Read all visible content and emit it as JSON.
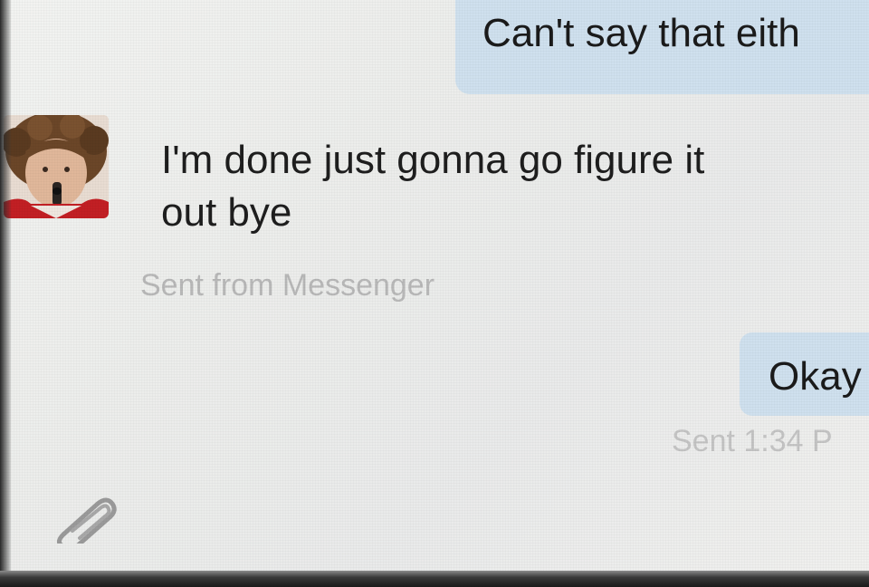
{
  "conversation": {
    "messages": [
      {
        "direction": "outgoing",
        "text": "Can't say that eith"
      },
      {
        "direction": "incoming",
        "text_line1": "I'm done just gonna go figure it",
        "text_line2": "out bye",
        "meta": "Sent from Messenger"
      },
      {
        "direction": "outgoing",
        "text": "Okay",
        "meta": "Sent 1:34 P"
      }
    ]
  },
  "icons": {
    "avatar": "contact-avatar-photo",
    "attach": "paperclip-icon"
  },
  "colors": {
    "outgoing_bubble": "#cfe0ee",
    "background": "#eeefed",
    "meta_text": "#b8b8b8"
  }
}
